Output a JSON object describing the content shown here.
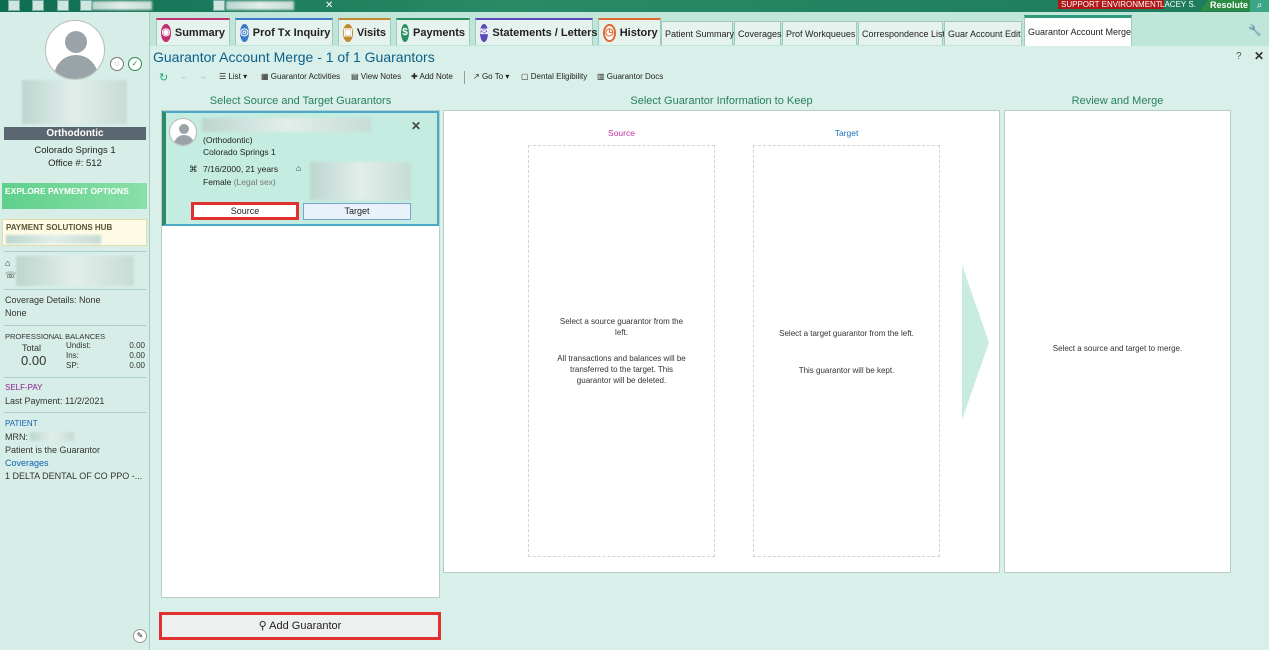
{
  "env": {
    "support": "SUPPORT ENVIRONMENT",
    "user": "LACEY S.",
    "app": "Resolute"
  },
  "tabs": [
    {
      "label": "Summary"
    },
    {
      "label": "Prof Tx Inquiry"
    },
    {
      "label": "Visits"
    },
    {
      "label": "Payments"
    },
    {
      "label": "Statements / Letters"
    },
    {
      "label": "History"
    },
    {
      "label": "Patient Summary"
    },
    {
      "label": "Coverages"
    },
    {
      "label": "Prof Workqueues"
    },
    {
      "label": "Correspondence List"
    },
    {
      "label": "Guar Account Edit"
    },
    {
      "label": "Guarantor Account Merge"
    }
  ],
  "sidebar": {
    "department": "Orthodontic",
    "location": "Colorado Springs 1",
    "office": "Office #: 512",
    "explore": "EXPLORE PAYMENT OPTIONS",
    "payhub": "PAYMENT SOLUTIONS HUB",
    "coverage_details": "Coverage Details: None",
    "coverage_none": "None",
    "balances_title": "PROFESSIONAL BALANCES",
    "total_label": "Total",
    "total_value": "0.00",
    "undist_label": "Undist:",
    "undist_value": "0.00",
    "ins_label": "Ins:",
    "ins_value": "0.00",
    "sp_label": "SP:",
    "sp_value": "0.00",
    "selfpay_title": "SELF-PAY",
    "last_payment": "Last Payment: 11/2/2021",
    "patient_title": "PATIENT",
    "mrn_label": "MRN:",
    "patient_guarantor": "Patient is the Guarantor",
    "coverages_link": "Coverages",
    "coverage_item": "1  DELTA DENTAL OF CO PPO -..."
  },
  "main": {
    "title": "Guarantor Account Merge - 1 of 1 Guarantors",
    "toolbar": {
      "list": "List",
      "activities": "Guarantor Activities",
      "view_notes": "View Notes",
      "add_note": "Add Note",
      "go_to": "Go To",
      "dental": "Dental Eligibility",
      "docs": "Guarantor Docs"
    },
    "col1_title": "Select Source and Target Guarantors",
    "col2_title": "Select Guarantor Information to Keep",
    "col3_title": "Review and Merge",
    "card": {
      "dept": "(Orthodontic)",
      "location": "Colorado Springs 1",
      "dob": "7/16/2000, 21 years",
      "sex": "Female",
      "sex_note": "(Legal sex)",
      "source_btn": "Source",
      "target_btn": "Target"
    },
    "source_label": "Source",
    "target_label": "Target",
    "source_ph1": "Select a source guarantor from the left.",
    "source_ph2": "All transactions and balances will be transferred to the target. This guarantor will be deleted.",
    "target_ph1": "Select a target guarantor from the left.",
    "target_ph2": "This guarantor will be kept.",
    "review_ph": "Select a source and target to merge.",
    "add_guarantor": "Add Guarantor"
  },
  "colors": {
    "accent": "#2f9a7c",
    "title": "#0b5f8a",
    "highlight": "#e03030"
  }
}
